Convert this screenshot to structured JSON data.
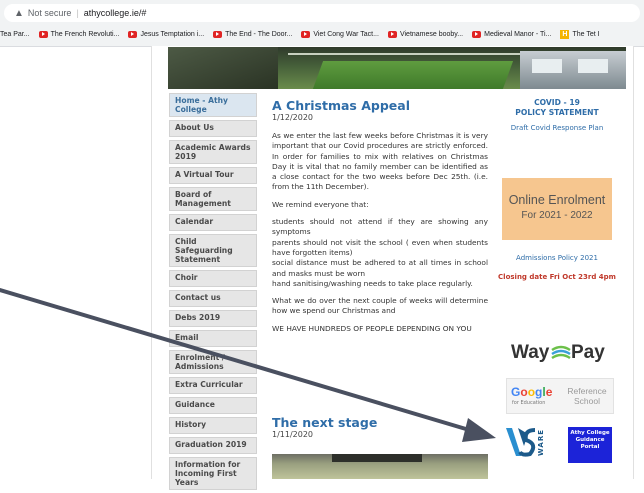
{
  "browser": {
    "security_label": "Not secure",
    "url": "athycollege.ie/#",
    "bookmarks": [
      {
        "icon": "none",
        "label": "Tea Par..."
      },
      {
        "icon": "youtube-icon",
        "label": "The French Revoluti..."
      },
      {
        "icon": "youtube-icon",
        "label": "Jesus Temptation i..."
      },
      {
        "icon": "youtube-icon",
        "label": "The End - The Door..."
      },
      {
        "icon": "youtube-icon",
        "label": "Viet Cong War Tact..."
      },
      {
        "icon": "youtube-icon",
        "label": "Vietnamese booby..."
      },
      {
        "icon": "youtube-icon",
        "label": "Medieval Manor - Ti..."
      },
      {
        "icon": "h-icon",
        "label": "The Tet I"
      }
    ]
  },
  "nav": {
    "items": [
      {
        "label": "Home - Athy College",
        "active": true
      },
      {
        "label": "About Us"
      },
      {
        "label": "Academic Awards 2019"
      },
      {
        "label": "A Virtual Tour"
      },
      {
        "label": "Board of Management"
      },
      {
        "label": "Calendar"
      },
      {
        "label": "Child Safeguarding Statement"
      },
      {
        "label": "Choir"
      },
      {
        "label": "Contact us"
      },
      {
        "label": "Debs 2019"
      },
      {
        "label": "Email"
      },
      {
        "label": "Enrolment / Admissions"
      },
      {
        "label": "Extra Curricular"
      },
      {
        "label": "Guidance"
      },
      {
        "label": "History"
      },
      {
        "label": "Graduation 2019"
      },
      {
        "label": "Information for Incoming First Years"
      }
    ]
  },
  "post1": {
    "title": "A Christmas Appeal",
    "date": "1/12/2020",
    "p1": "As we enter the last few weeks before Christmas it is very important that our Covid procedures are strictly enforced.  In order for families to mix with relatives on Christmas Day it is vital that no family member can be identified as a close contact for the two weeks before Dec 25th. (i.e. from the 11th December).",
    "p2": "We remind everyone that:",
    "p3": "students should not attend if they are showing any symptoms",
    "p4": "parents should not visit the school ( even when students have forgotten items)",
    "p5": "social distance must be adhered to at all times in school and masks must be worn",
    "p6": "hand sanitising/washing needs to take place regularly.",
    "p7": "What we do over the next couple of weeks will determine how we spend our Christmas and",
    "p8": "WE HAVE HUNDREDS OF PEOPLE DEPENDING ON YOU"
  },
  "post2": {
    "title": "The next stage",
    "date": "1/11/2020"
  },
  "sidebar": {
    "covid_title_1": "COVID - 19",
    "covid_title_2": "POLICY STATEMENT",
    "covid_link": "Draft Covid Response Plan",
    "enrol_1": "Online Enrolment",
    "enrol_2": "For 2021 - 2022",
    "admissions": "Admissions Policy 2021",
    "closing": "Closing date Fri Oct 23rd 4pm",
    "waypay_left": "Way",
    "waypay_right": "Pay",
    "google": "Google",
    "google_sub": "for Education",
    "reference": "Reference School",
    "vsware": "WARE",
    "portal": "Athy College Guidance Portal"
  },
  "colors": {
    "link_blue": "#2f6da8",
    "enrol_bg": "#f6c68f",
    "closing_red": "#c0392b",
    "portal_blue": "#1c23d8",
    "arrow": "#4a5060"
  }
}
